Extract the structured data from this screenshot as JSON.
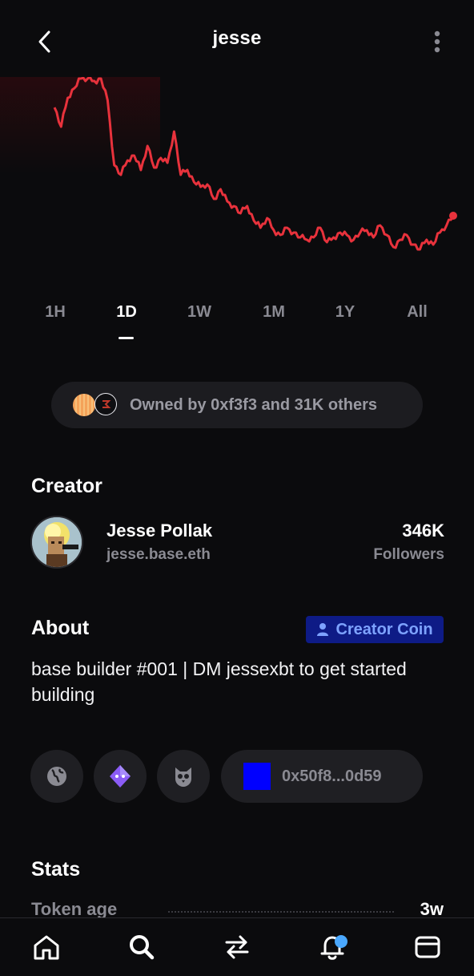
{
  "header": {
    "title": "jesse"
  },
  "chart_data": {
    "type": "line",
    "x_label": "",
    "y_label": "",
    "series": [
      {
        "values": [
          88,
          80,
          92,
          96,
          100,
          100,
          99,
          100,
          91,
          64,
          60,
          66,
          68,
          62,
          72,
          63,
          67,
          65,
          78,
          60,
          62,
          57,
          55,
          56,
          50,
          54,
          49,
          47,
          44,
          47,
          41,
          38,
          42,
          37,
          35,
          38,
          36,
          34,
          33,
          34,
          38,
          32,
          34,
          36,
          35,
          33,
          36,
          37,
          34,
          39,
          35,
          30,
          33,
          35,
          31,
          29,
          33,
          31,
          36,
          39,
          43
        ],
        "color": "#e8323c"
      }
    ]
  },
  "ranges": {
    "items": [
      "1H",
      "1D",
      "1W",
      "1M",
      "1Y",
      "All"
    ],
    "active": "1D"
  },
  "owners": {
    "text": "Owned by 0xf3f3 and 31K others"
  },
  "creator": {
    "section_title": "Creator",
    "name": "Jesse Pollak",
    "handle": "jesse.base.eth",
    "followers_count": "346K",
    "followers_label": "Followers"
  },
  "about": {
    "section_title": "About",
    "badge": "Creator Coin",
    "text": "base builder #001 | DM jessexbt to get started building"
  },
  "links": {
    "address": "0x50f8...0d59"
  },
  "stats": {
    "section_title": "Stats",
    "rows": [
      {
        "label": "Token age",
        "value": "3w"
      }
    ]
  },
  "colors": {
    "background": "#0b0b0d",
    "accent_red": "#e8323c",
    "badge_blue": "#0e1b86",
    "notification": "#4aa8ff"
  },
  "tabbar": {
    "icons": [
      "home-icon",
      "search-icon",
      "swap-icon",
      "bell-icon",
      "wallet-icon"
    ],
    "active": "search-icon"
  }
}
